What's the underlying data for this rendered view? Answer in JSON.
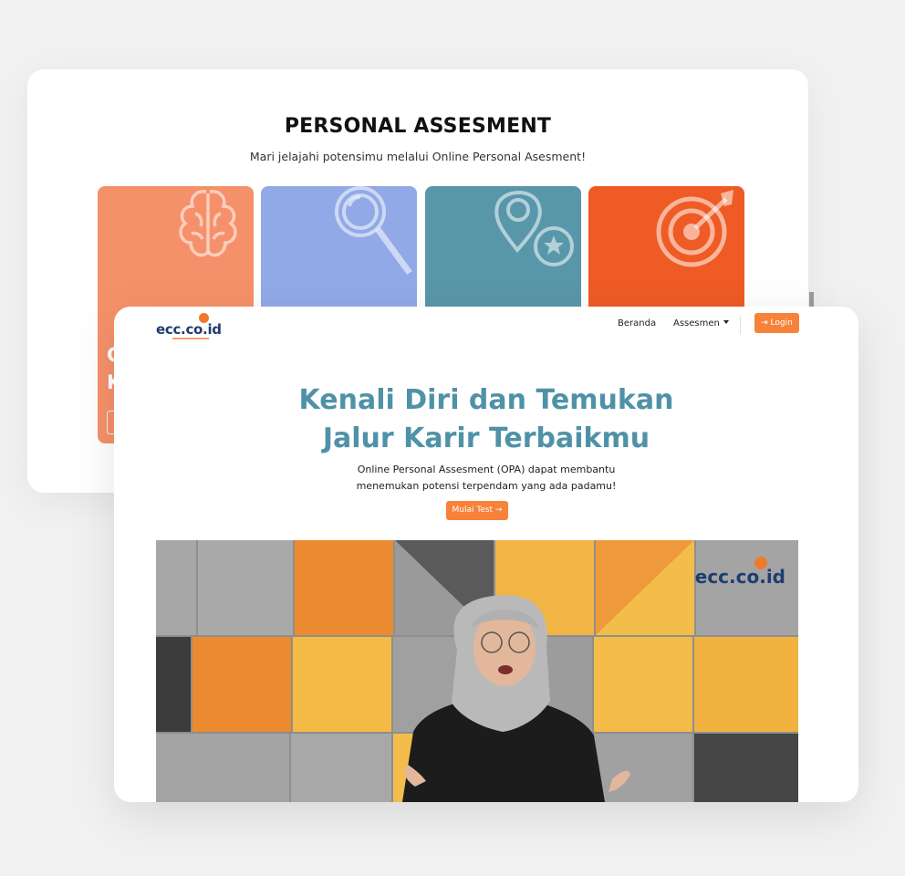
{
  "personal_assessment": {
    "title": "PERSONAL ASSESMENT",
    "subtitle": "Mari jelajahi potensimu melalui Online Personal Asesment!",
    "tiles": [
      {
        "icon": "brain-icon",
        "color": "#f5916a"
      },
      {
        "icon": "magnifier-icon",
        "color": "#91a9e6"
      },
      {
        "icon": "location-star-icon",
        "color": "#5897a9"
      },
      {
        "icon": "target-icon",
        "color": "#ef5b25"
      }
    ]
  },
  "nav": {
    "logo_text": "ecc.co.id",
    "beranda": "Beranda",
    "asesmen": "Assesmen",
    "login": "⇥ Login"
  },
  "hero": {
    "title_line1": "Kenali Diri dan Temukan",
    "title_line2": "Jalur Karir Terbaikmu",
    "desc_line1": "Online Personal Assesment (OPA) dapat membantu",
    "desc_line2": "menemukan potensi terpendam yang ada padamu!",
    "cta": "Mulai Test →"
  },
  "video": {
    "watermark": "ecc.co.id"
  },
  "colors": {
    "accent": "#f7823a",
    "heading": "#4f92a8",
    "brand_navy": "#1d3d6e"
  }
}
